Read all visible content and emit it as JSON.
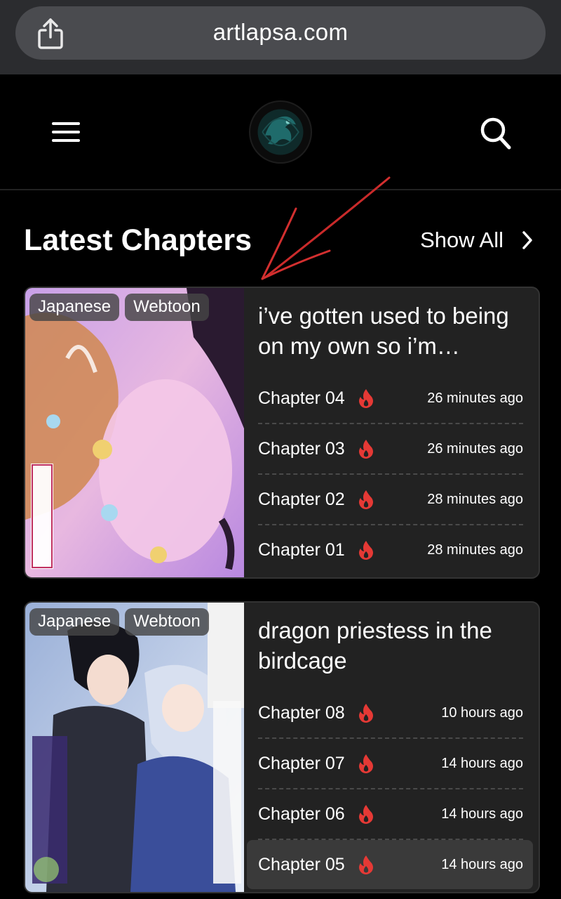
{
  "browser": {
    "url": "artlapsa.com"
  },
  "header": {
    "menu_icon": "hamburger-icon",
    "logo": "site-logo",
    "search_icon": "search-icon"
  },
  "section": {
    "title": "Latest Chapters",
    "show_all": "Show All"
  },
  "colors": {
    "background": "#000000",
    "card": "#222222",
    "fire": "#e53935",
    "annotation_arrow": "#d32f2f"
  },
  "cards": [
    {
      "badges": [
        "Japanese",
        "Webtoon"
      ],
      "title": "i’ve gotten used to being on my own so i’m…",
      "chapters": [
        {
          "label": "Chapter 04",
          "time": "26 minutes ago"
        },
        {
          "label": "Chapter 03",
          "time": "26 minutes ago"
        },
        {
          "label": "Chapter 02",
          "time": "28 minutes ago"
        },
        {
          "label": "Chapter 01",
          "time": "28 minutes ago"
        }
      ]
    },
    {
      "badges": [
        "Japanese",
        "Webtoon"
      ],
      "title": "dragon priestess in the birdcage",
      "chapters": [
        {
          "label": "Chapter 08",
          "time": "10 hours ago"
        },
        {
          "label": "Chapter 07",
          "time": "14 hours ago"
        },
        {
          "label": "Chapter 06",
          "time": "14 hours ago"
        },
        {
          "label": "Chapter 05",
          "time": "14 hours ago"
        }
      ]
    }
  ]
}
